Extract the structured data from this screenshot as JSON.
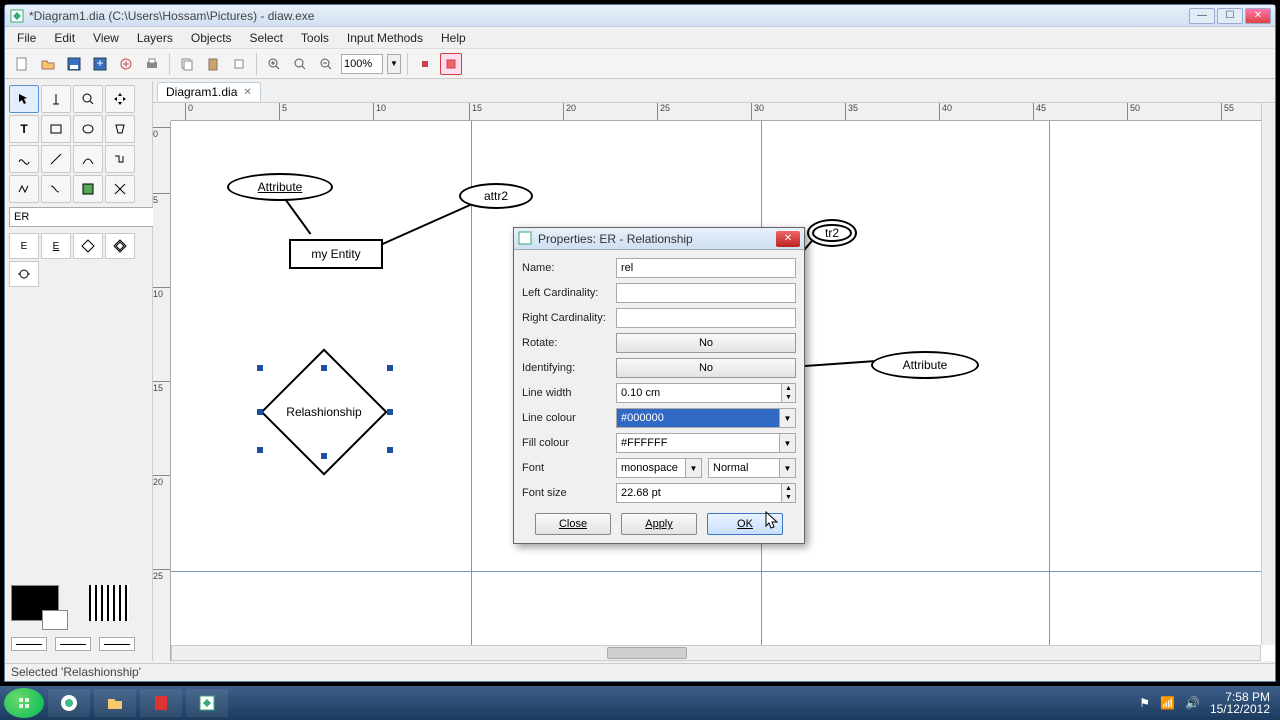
{
  "window": {
    "title": "*Diagram1.dia (C:\\Users\\Hossam\\Pictures) - diaw.exe"
  },
  "menu": [
    "File",
    "Edit",
    "View",
    "Layers",
    "Objects",
    "Select",
    "Tools",
    "Input Methods",
    "Help"
  ],
  "toolbar": {
    "zoom": "100%"
  },
  "tab": {
    "label": "Diagram1.dia"
  },
  "ruler_h": [
    "0",
    "5",
    "10",
    "15",
    "20",
    "25",
    "30",
    "35",
    "40",
    "45",
    "50",
    "55"
  ],
  "ruler_v": [
    "0",
    "5",
    "10",
    "15",
    "20",
    "25"
  ],
  "toolbox": {
    "sheet": "ER",
    "er_icons": [
      "E",
      "E",
      "R",
      "R"
    ]
  },
  "canvas": {
    "attr1": "Attribute",
    "attr2": "attr2",
    "entity": "my Entity",
    "attr3_partial": "tr2",
    "rel": "Relashionship",
    "attr4": "Attribute"
  },
  "dialog": {
    "title": "Properties: ER - Relationship",
    "labels": {
      "name": "Name:",
      "leftcard": "Left Cardinality:",
      "rightcard": "Right Cardinality:",
      "rotate": "Rotate:",
      "identifying": "Identifying:",
      "linewidth": "Line width",
      "linecolour": "Line colour",
      "fillcolour": "Fill colour",
      "font": "Font",
      "fontsize": "Font size"
    },
    "values": {
      "name": "rel",
      "leftcard": "",
      "rightcard": "",
      "rotate": "No",
      "identifying": "No",
      "linewidth": "0.10 cm",
      "linecolour": "#000000",
      "fillcolour": "#FFFFFF",
      "fontfamily": "monospace",
      "fontstyle": "Normal",
      "fontsize": "22.68 pt"
    },
    "buttons": {
      "close": "Close",
      "apply": "Apply",
      "ok": "OK"
    }
  },
  "status": "Selected 'Relashionship'",
  "taskbar": {
    "time": "7:58 PM",
    "date": "15/12/2012"
  }
}
